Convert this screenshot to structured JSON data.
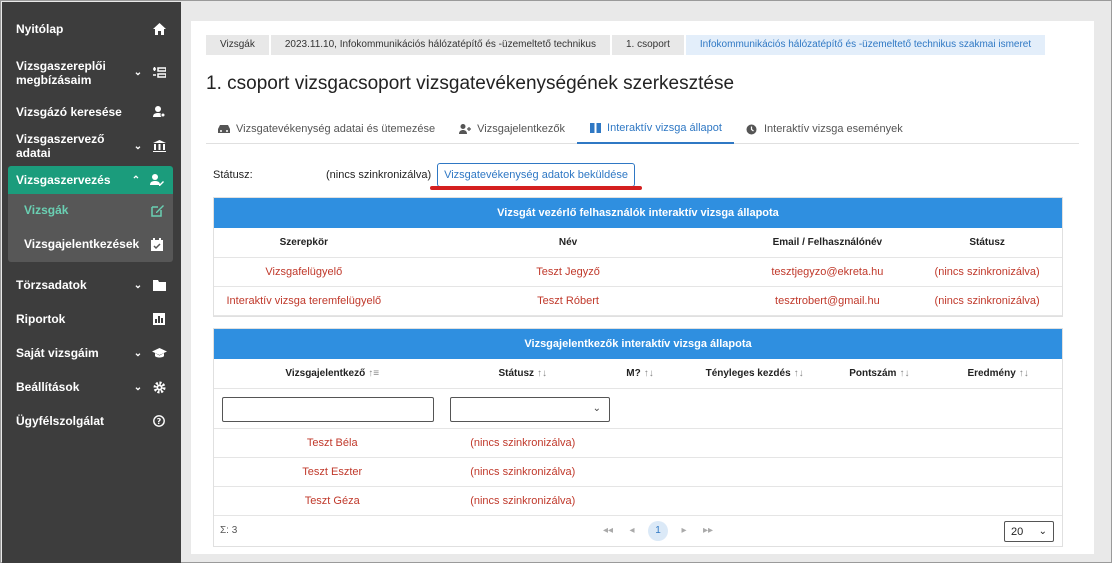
{
  "sidebar": {
    "items": [
      {
        "label": "Nyitólap",
        "icon": "home-icon"
      },
      {
        "label": "Vizsgaszereplői megbízásaim",
        "icon": "assignment-icon"
      },
      {
        "label": "Vizsgázó keresése",
        "icon": "user-search-icon"
      },
      {
        "label": "Vizsgaszervező adatai",
        "icon": "institution-icon"
      },
      {
        "label": "Vizsgaszervezés",
        "icon": "user-edit-icon"
      },
      {
        "label": "Vizsgák",
        "icon": "edit-icon"
      },
      {
        "label": "Vizsgajelentkezések",
        "icon": "calendar-check-icon"
      },
      {
        "label": "Törzsadatok",
        "icon": "folder-icon"
      },
      {
        "label": "Riportok",
        "icon": "chart-icon"
      },
      {
        "label": "Saját vizsgáim",
        "icon": "graduation-cap-icon"
      },
      {
        "label": "Beállítások",
        "icon": "gear-icon"
      },
      {
        "label": "Ügyfélszolgálat",
        "icon": "help-icon"
      }
    ]
  },
  "breadcrumbs": [
    "Vizsgák",
    "2023.11.10, Infokommunikációs hálózatépítő és -üzemeltető technikus",
    "1. csoport",
    "Infokommunikációs hálózatépítő és -üzemeltető technikus szakmai ismeret"
  ],
  "page_title": "1. csoport vizsgacsoport vizsgatevékenységének szerkesztése",
  "tabs": [
    {
      "label": "Vizsgatevékenység adatai és ütemezése",
      "icon": "car-icon"
    },
    {
      "label": "Vizsgajelentkezők",
      "icon": "user-plus-icon"
    },
    {
      "label": "Interaktív vizsga állapot",
      "icon": "book-icon"
    },
    {
      "label": "Interaktív vizsga események",
      "icon": "clock-icon"
    }
  ],
  "status": {
    "label": "Státusz:",
    "value": "(nincs szinkronizálva)",
    "send_button": "Vizsgatevékenység adatok beküldése"
  },
  "users_panel": {
    "title": "Vizsgát vezérlő felhasználók interaktív vizsga állapota",
    "columns": [
      "Szerepkör",
      "Név",
      "Email / Felhasználónév",
      "Státusz"
    ],
    "rows": [
      [
        "Vizsgafelügyelő",
        "Teszt Jegyző",
        "tesztjegyzo@ekreta.hu",
        "(nincs szinkronizálva)"
      ],
      [
        "Interaktív vizsga teremfelügyelő",
        "Teszt Róbert",
        "tesztrobert@gmail.hu",
        "(nincs szinkronizálva)"
      ]
    ]
  },
  "applicants_panel": {
    "title": "Vizsgajelentkezők interaktív vizsga állapota",
    "columns": [
      "Vizsgajelentkező",
      "Státusz",
      "M?",
      "Tényleges kezdés",
      "Pontszám",
      "Eredmény"
    ],
    "rows": [
      [
        "Teszt Béla",
        "(nincs szinkronizálva)"
      ],
      [
        "Teszt Eszter",
        "(nincs szinkronizálva)"
      ],
      [
        "Teszt Géza",
        "(nincs szinkronizálva)"
      ]
    ],
    "summary": "Σ: 3",
    "current_page": "1",
    "page_size": "20"
  }
}
